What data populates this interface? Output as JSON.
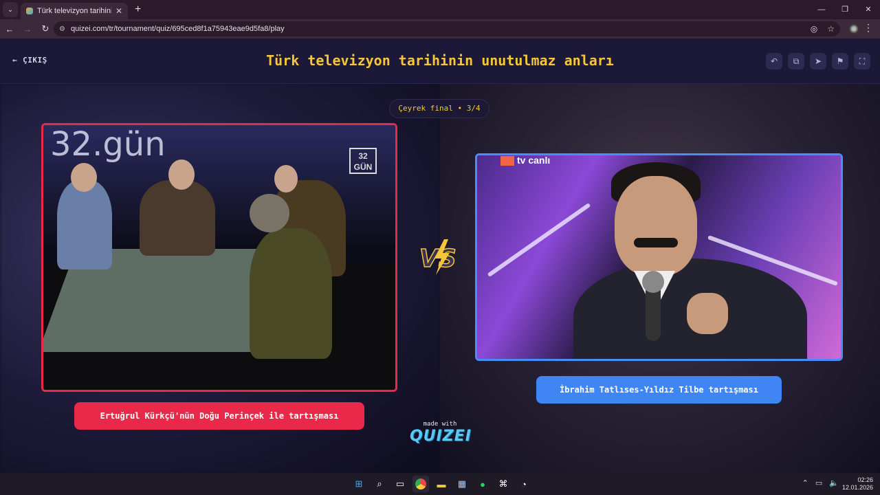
{
  "browser": {
    "tab_title": "Türk televizyon tarihinin unutul",
    "tab_close": "✕",
    "new_tab": "+",
    "url": "quizei.com/tr/tournament/quiz/695ced8f1a75943eae9d5fa8/play",
    "window_controls": [
      "—",
      "❐",
      "✕"
    ]
  },
  "header": {
    "exit_label": "ÇIKIŞ",
    "title": "Türk televizyon tarihinin unutulmaz anları",
    "tools": [
      "undo-icon",
      "layers-icon",
      "send-icon",
      "flag-icon",
      "fullscreen-icon"
    ]
  },
  "round": {
    "label": "Çeyrek final • 3/4"
  },
  "left_card": {
    "caption": "Ertuğrul Kürkçü'nün Doğu Perinçek ile tartışması",
    "logo_text": "32\nGÜN",
    "bg_text": "32.gün",
    "accent": "#e8294a"
  },
  "right_card": {
    "caption": "İbrahim Tatlıses-Yıldız Tilbe tartışması",
    "logo_text": "tv canlı",
    "accent": "#3f86f4"
  },
  "vs": {
    "text": "VS",
    "color": "#f6c63a"
  },
  "footer": {
    "made_with": "made with",
    "brand": "QUIZEI"
  },
  "taskbar": {
    "icons": [
      "windows-icon",
      "search-icon",
      "taskview-icon",
      "chrome-icon",
      "explorer-icon",
      "store-icon",
      "spotify-icon",
      "capcut-icon",
      "other-app-icon"
    ],
    "time": "02:26",
    "date": "12.01.2026"
  }
}
